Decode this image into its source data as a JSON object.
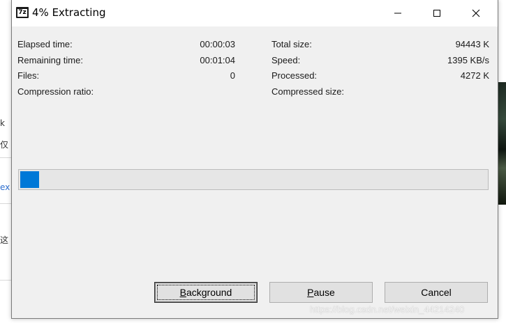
{
  "window": {
    "title": "4% Extracting"
  },
  "stats_left": [
    {
      "label": "Elapsed time:",
      "value": "00:00:03"
    },
    {
      "label": "Remaining time:",
      "value": "00:01:04"
    },
    {
      "label": "Files:",
      "value": "0"
    },
    {
      "label": "Compression ratio:",
      "value": ""
    }
  ],
  "stats_right": [
    {
      "label": "Total size:",
      "value": "94443 K"
    },
    {
      "label": "Speed:",
      "value": "1395 KB/s"
    },
    {
      "label": "Processed:",
      "value": "4272 K"
    },
    {
      "label": "Compressed size:",
      "value": ""
    }
  ],
  "progress": {
    "percent": 4
  },
  "buttons": {
    "background": {
      "prefix": "",
      "accel": "B",
      "rest": "ackground"
    },
    "pause": {
      "prefix": "",
      "accel": "P",
      "rest": "ause"
    },
    "cancel": "Cancel"
  },
  "watermark": "https://blog.csdn.net/weixin_44214240",
  "background_window": {
    "glyphs": [
      "k",
      "仅",
      "ex",
      "这"
    ]
  },
  "colors": {
    "accent": "#0078d7",
    "dialog_bg": "#f0f0f0"
  },
  "icons": [
    "7zip-app-icon",
    "minimize-icon",
    "maximize-icon",
    "close-icon"
  ]
}
